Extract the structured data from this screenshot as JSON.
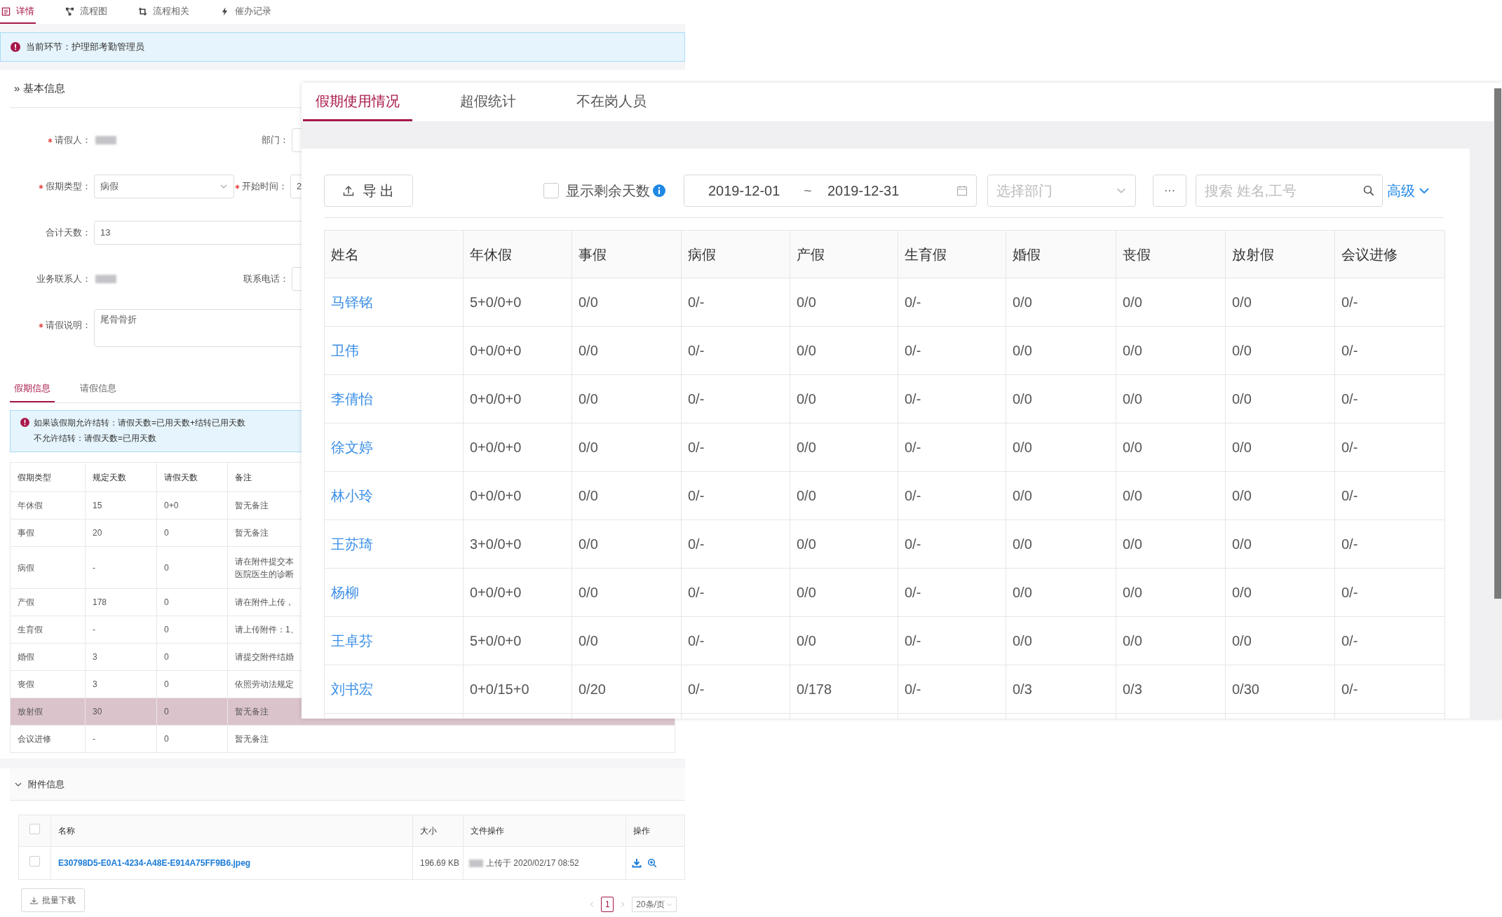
{
  "detail": {
    "tabs": [
      {
        "label": "详情",
        "selected": true
      },
      {
        "label": "流程图",
        "selected": false
      },
      {
        "label": "流程相关",
        "selected": false
      },
      {
        "label": "催办记录",
        "selected": false
      }
    ],
    "notice": "当前环节：护理部考勤管理员",
    "section_title": "» 基本信息",
    "form_rows": [
      [
        {
          "label": "请假人：",
          "required": true,
          "kind": "redacted"
        },
        {
          "label": "部门：",
          "required": false,
          "kind": "input"
        }
      ],
      [
        {
          "label": "假期类型：",
          "required": true,
          "kind": "select",
          "value": "病假"
        },
        {
          "label": "开始时间：",
          "required": true,
          "kind": "input",
          "value": "2"
        }
      ],
      [
        {
          "label": "合计天数：",
          "required": false,
          "kind": "input",
          "value": "13"
        }
      ],
      [
        {
          "label": "业务联系人：",
          "required": false,
          "kind": "redacted"
        },
        {
          "label": "联系电话：",
          "required": false,
          "kind": "input"
        }
      ],
      [
        {
          "label": "请假说明：",
          "required": true,
          "kind": "textarea",
          "value": "尾骨骨折"
        }
      ]
    ],
    "leave_tabs": [
      {
        "label": "假期信息",
        "selected": true
      },
      {
        "label": "请假信息",
        "selected": false
      }
    ],
    "leave_notice": [
      "如果该假期允许结转：请假天数=已用天数+结转已用天数",
      "不允许结转：请假天数=已用天数"
    ],
    "leave_table": {
      "columns": [
        "假期类型",
        "规定天数",
        "请假天数",
        "备注"
      ],
      "rows": [
        {
          "cells": [
            "年休假",
            "15",
            "0+0",
            "暂无备注"
          ],
          "selected": false
        },
        {
          "cells": [
            "事假",
            "20",
            "0",
            "暂无备注"
          ],
          "selected": false
        },
        {
          "cells": [
            "病假",
            "-",
            "0",
            [
              "请在附件提交本",
              "医院医生的诊断"
            ]
          ],
          "selected": false
        },
        {
          "cells": [
            "产假",
            "178",
            "0",
            "请在附件上传，"
          ],
          "selected": false
        },
        {
          "cells": [
            "生育假",
            "-",
            "0",
            "请上传附件：1、"
          ],
          "selected": false
        },
        {
          "cells": [
            "婚假",
            "3",
            "0",
            "请提交附件结婚"
          ],
          "selected": false
        },
        {
          "cells": [
            "丧假",
            "3",
            "0",
            "依照劳动法规定"
          ],
          "selected": false
        },
        {
          "cells": [
            "放射假",
            "30",
            "0",
            "暂无备注"
          ],
          "selected": true
        },
        {
          "cells": [
            "会议进修",
            "-",
            "0",
            "暂无备注"
          ],
          "selected": false
        }
      ]
    },
    "attachments": {
      "title": "附件信息",
      "expanded": true,
      "all_checked": false,
      "columns": [
        "名称",
        "大小",
        "文件操作",
        "操作"
      ],
      "rows": [
        {
          "name": "E30798D5-E0A1-4234-A48E-E914A75FF9B6.jpeg",
          "size": "196.69 KB",
          "uploaded": "上传于 2020/02/17 08:52",
          "checked": false
        }
      ],
      "batch_button": "批量下载",
      "pagination": {
        "page": "1",
        "page_size": "20条/页"
      }
    }
  },
  "stats": {
    "tabs": [
      {
        "label": "假期使用情况",
        "selected": true
      },
      {
        "label": "超假统计",
        "selected": false
      },
      {
        "label": "不在岗人员",
        "selected": false
      }
    ],
    "export_button": "导 出",
    "show_remaining": {
      "label": "显示剩余天数",
      "checked": false
    },
    "date_range": {
      "start": "2019-12-01",
      "separator": "~",
      "end": "2019-12-31"
    },
    "department": {
      "placeholder": "选择部门"
    },
    "more_button": "···",
    "search": {
      "placeholder": "搜索 姓名,工号"
    },
    "advanced": "高级",
    "table": {
      "columns": [
        "姓名",
        "年休假",
        "事假",
        "病假",
        "产假",
        "生育假",
        "婚假",
        "丧假",
        "放射假",
        "会议进修"
      ],
      "rows": [
        [
          "马铎铭",
          "5+0/0+0",
          "0/0",
          "0/-",
          "0/0",
          "0/-",
          "0/0",
          "0/0",
          "0/0",
          "0/-"
        ],
        [
          "卫伟",
          "0+0/0+0",
          "0/0",
          "0/-",
          "0/0",
          "0/-",
          "0/0",
          "0/0",
          "0/0",
          "0/-"
        ],
        [
          "李倩怡",
          "0+0/0+0",
          "0/0",
          "0/-",
          "0/0",
          "0/-",
          "0/0",
          "0/0",
          "0/0",
          "0/-"
        ],
        [
          "徐文婷",
          "0+0/0+0",
          "0/0",
          "0/-",
          "0/0",
          "0/-",
          "0/0",
          "0/0",
          "0/0",
          "0/-"
        ],
        [
          "林小玲",
          "0+0/0+0",
          "0/0",
          "0/-",
          "0/0",
          "0/-",
          "0/0",
          "0/0",
          "0/0",
          "0/-"
        ],
        [
          "王苏琦",
          "3+0/0+0",
          "0/0",
          "0/-",
          "0/0",
          "0/-",
          "0/0",
          "0/0",
          "0/0",
          "0/-"
        ],
        [
          "杨柳",
          "0+0/0+0",
          "0/0",
          "0/-",
          "0/0",
          "0/-",
          "0/0",
          "0/0",
          "0/0",
          "0/-"
        ],
        [
          "王卓芬",
          "5+0/0+0",
          "0/0",
          "0/-",
          "0/0",
          "0/-",
          "0/0",
          "0/0",
          "0/0",
          "0/-"
        ],
        [
          "刘书宏",
          "0+0/15+0",
          "0/20",
          "0/-",
          "0/178",
          "0/-",
          "0/3",
          "0/3",
          "0/30",
          "0/-"
        ]
      ]
    }
  }
}
